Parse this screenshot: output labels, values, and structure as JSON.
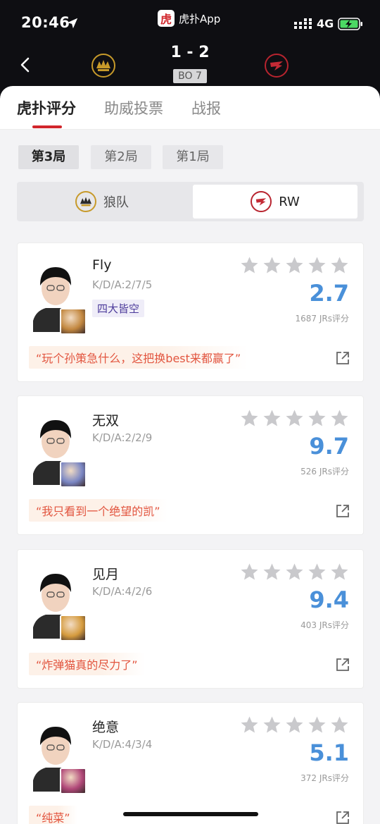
{
  "status": {
    "time": "20:46",
    "network": "4G"
  },
  "app": {
    "logo_char": "虎",
    "name": "虎扑App"
  },
  "match": {
    "score": "1 - 2",
    "format": "BO 7"
  },
  "tabs": [
    {
      "label": "虎扑评分",
      "active": true
    },
    {
      "label": "助威投票",
      "active": false
    },
    {
      "label": "战报",
      "active": false
    }
  ],
  "games": [
    {
      "label": "第3局",
      "active": true
    },
    {
      "label": "第2局",
      "active": false
    },
    {
      "label": "第1局",
      "active": false
    }
  ],
  "teams": [
    {
      "name": "狼队",
      "active": false
    },
    {
      "name": "RW",
      "active": true
    }
  ],
  "players": [
    {
      "name": "Fly",
      "kda": "K/D/A:2/7/5",
      "tag": "四大皆空",
      "score": "2.7",
      "votes": "1687 JRs评分",
      "quote": "“玩个孙策急什么，这把换best来都赢了”",
      "hero_color": "#c2873f"
    },
    {
      "name": "无双",
      "kda": "K/D/A:2/2/9",
      "tag": "",
      "score": "9.7",
      "votes": "526 JRs评分",
      "quote": "“我只看到一个绝望的凯”",
      "hero_color": "#7a86c4"
    },
    {
      "name": "见月",
      "kda": "K/D/A:4/2/6",
      "tag": "",
      "score": "9.4",
      "votes": "403 JRs评分",
      "quote": "“炸弹猫真的尽力了”",
      "hero_color": "#d59b3e"
    },
    {
      "name": "绝意",
      "kda": "K/D/A:4/3/4",
      "tag": "",
      "score": "5.1",
      "votes": "372 JRs评分",
      "quote": "“纯菜”",
      "hero_color": "#b04778"
    }
  ],
  "colors": {
    "accent": "#d1252b",
    "score_blue": "#4a90d9",
    "quote_orange": "#e2553f"
  }
}
